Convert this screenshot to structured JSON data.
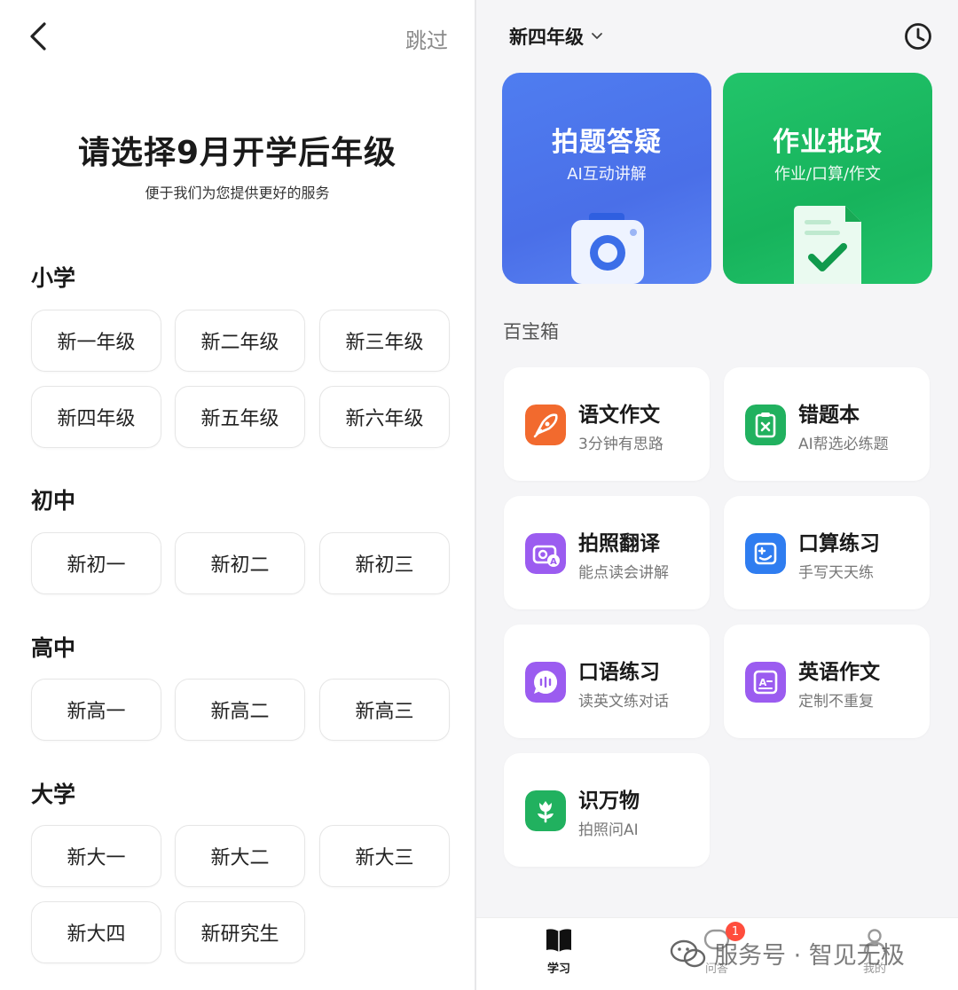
{
  "left": {
    "skip_label": "跳过",
    "title": "请选择9月开学后年级",
    "subtitle": "便于我们为您提供更好的服务",
    "sections": [
      {
        "name": "小学",
        "grades": [
          "新一年级",
          "新二年级",
          "新三年级",
          "新四年级",
          "新五年级",
          "新六年级"
        ]
      },
      {
        "name": "初中",
        "grades": [
          "新初一",
          "新初二",
          "新初三"
        ]
      },
      {
        "name": "高中",
        "grades": [
          "新高一",
          "新高二",
          "新高三"
        ]
      },
      {
        "name": "大学",
        "grades": [
          "新大一",
          "新大二",
          "新大三",
          "新大四",
          "新研究生"
        ]
      }
    ]
  },
  "right": {
    "grade_selector": "新四年级",
    "big_cards": [
      {
        "title": "拍题答疑",
        "subtitle": "AI互动讲解",
        "color": "#4f7df0"
      },
      {
        "title": "作业批改",
        "subtitle": "作业/口算/作文",
        "color": "#1fbf64"
      }
    ],
    "toolbox_label": "百宝箱",
    "tools": [
      {
        "title": "语文作文",
        "subtitle": "3分钟有思路",
        "icon": "pen-icon",
        "color": "#f26a2e"
      },
      {
        "title": "错题本",
        "subtitle": "AI帮选必练题",
        "icon": "clipboard-x-icon",
        "color": "#21b15f"
      },
      {
        "title": "拍照翻译",
        "subtitle": "能点读会讲解",
        "icon": "camera-translate-icon",
        "color": "#9b5cf0"
      },
      {
        "title": "口算练习",
        "subtitle": "手写天天练",
        "icon": "calculator-icon",
        "color": "#2f7df0"
      },
      {
        "title": "口语练习",
        "subtitle": "读英文练对话",
        "icon": "speech-bubble-icon",
        "color": "#9b5cf0"
      },
      {
        "title": "英语作文",
        "subtitle": "定制不重复",
        "icon": "english-doc-icon",
        "color": "#9b5cf0"
      },
      {
        "title": "识万物",
        "subtitle": "拍照问AI",
        "icon": "flower-icon",
        "color": "#21b15f"
      }
    ],
    "nav": {
      "study_label": "学习",
      "qa_label": "问答",
      "qa_badge": "1",
      "me_label": "我的"
    },
    "watermark": "服务号 · 智见无极"
  }
}
